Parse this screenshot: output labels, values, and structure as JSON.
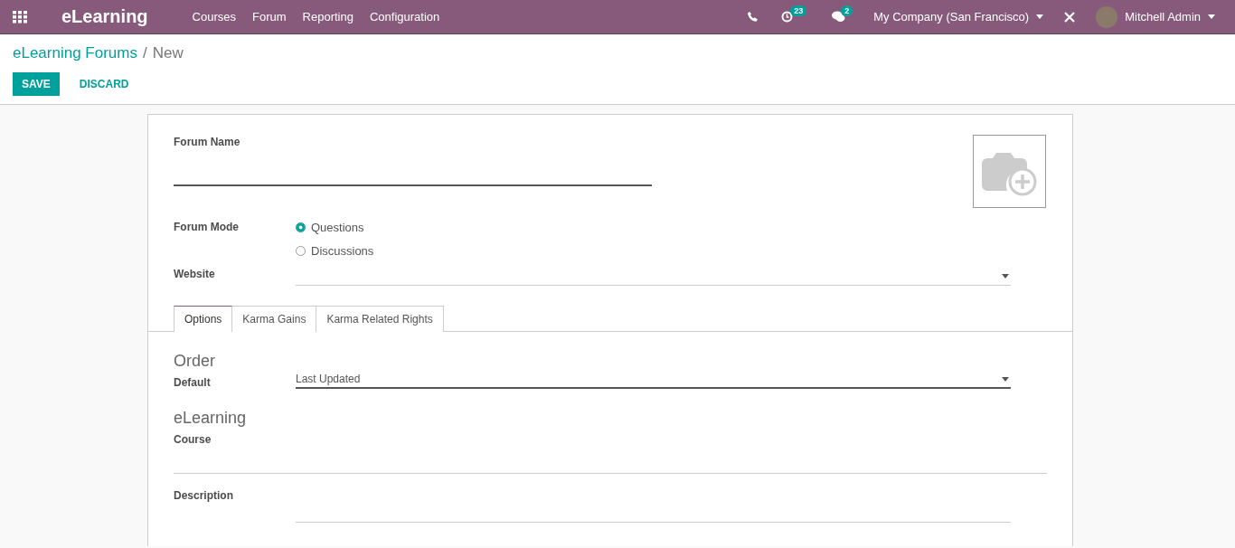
{
  "navbar": {
    "app_name": "eLearning",
    "menu": [
      "Courses",
      "Forum",
      "Reporting",
      "Configuration"
    ],
    "activity_count": "23",
    "message_count": "2",
    "company": "My Company (San Francisco)",
    "user": "Mitchell Admin"
  },
  "breadcrumb": {
    "parent": "eLearning Forums",
    "separator": "/",
    "current": "New"
  },
  "buttons": {
    "save": "SAVE",
    "discard": "DISCARD"
  },
  "form": {
    "name_label": "Forum Name",
    "mode_label": "Forum Mode",
    "modes": [
      {
        "label": "Questions",
        "selected": true
      },
      {
        "label": "Discussions",
        "selected": false
      }
    ],
    "website_label": "Website",
    "tabs": [
      {
        "label": "Options",
        "selected": true
      },
      {
        "label": "Karma Gains",
        "selected": false
      },
      {
        "label": "Karma Related Rights",
        "selected": false
      }
    ],
    "sections": [
      {
        "title": "Order",
        "fields": [
          {
            "label": "Default",
            "value": "Last Updated",
            "kind": "select"
          }
        ]
      },
      {
        "title": "eLearning",
        "fields": [
          {
            "label": "Course",
            "kind": "stacked"
          },
          {
            "label": "Description",
            "kind": "text"
          }
        ]
      }
    ]
  }
}
